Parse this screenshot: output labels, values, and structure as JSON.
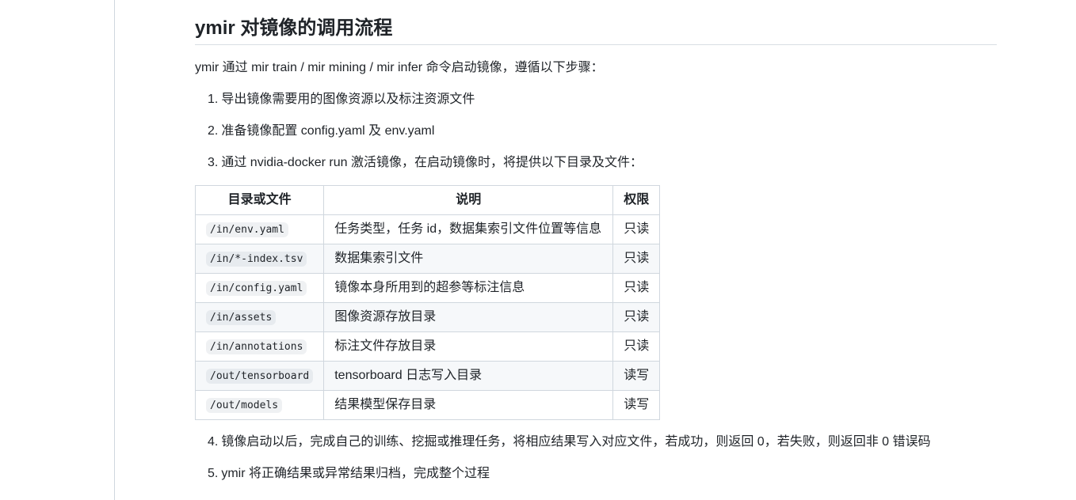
{
  "article": {
    "title": "ymir 对镜像的调用流程",
    "intro": "ymir 通过 mir train / mir mining / mir infer 命令启动镜像，遵循以下步骤：",
    "steps_before": [
      {
        "num": "1.",
        "text": "导出镜像需要用的图像资源以及标注资源文件"
      },
      {
        "num": "2.",
        "text": "准备镜像配置 config.yaml 及 env.yaml"
      },
      {
        "num": "3.",
        "text": "通过 nvidia-docker run 激活镜像，在启动镜像时，将提供以下目录及文件："
      }
    ],
    "table": {
      "headers": [
        "目录或文件",
        "说明",
        "权限"
      ],
      "rows": [
        {
          "path": "/in/env.yaml",
          "desc": "任务类型，任务 id，数据集索引文件位置等信息",
          "perm": "只读"
        },
        {
          "path": "/in/*-index.tsv",
          "desc": "数据集索引文件",
          "perm": "只读"
        },
        {
          "path": "/in/config.yaml",
          "desc": "镜像本身所用到的超参等标注信息",
          "perm": "只读"
        },
        {
          "path": "/in/assets",
          "desc": "图像资源存放目录",
          "perm": "只读"
        },
        {
          "path": "/in/annotations",
          "desc": "标注文件存放目录",
          "perm": "只读"
        },
        {
          "path": "/out/tensorboard",
          "desc": "tensorboard 日志写入目录",
          "perm": "读写"
        },
        {
          "path": "/out/models",
          "desc": "结果模型保存目录",
          "perm": "读写"
        }
      ]
    },
    "steps_after": [
      {
        "num": "4.",
        "text": "镜像启动以后，完成自己的训练、挖掘或推理任务，将相应结果写入对应文件，若成功，则返回 0，若失败，则返回非 0 错误码"
      },
      {
        "num": "5.",
        "text": "ymir 将正确结果或异常结果归档，完成整个过程"
      }
    ]
  }
}
